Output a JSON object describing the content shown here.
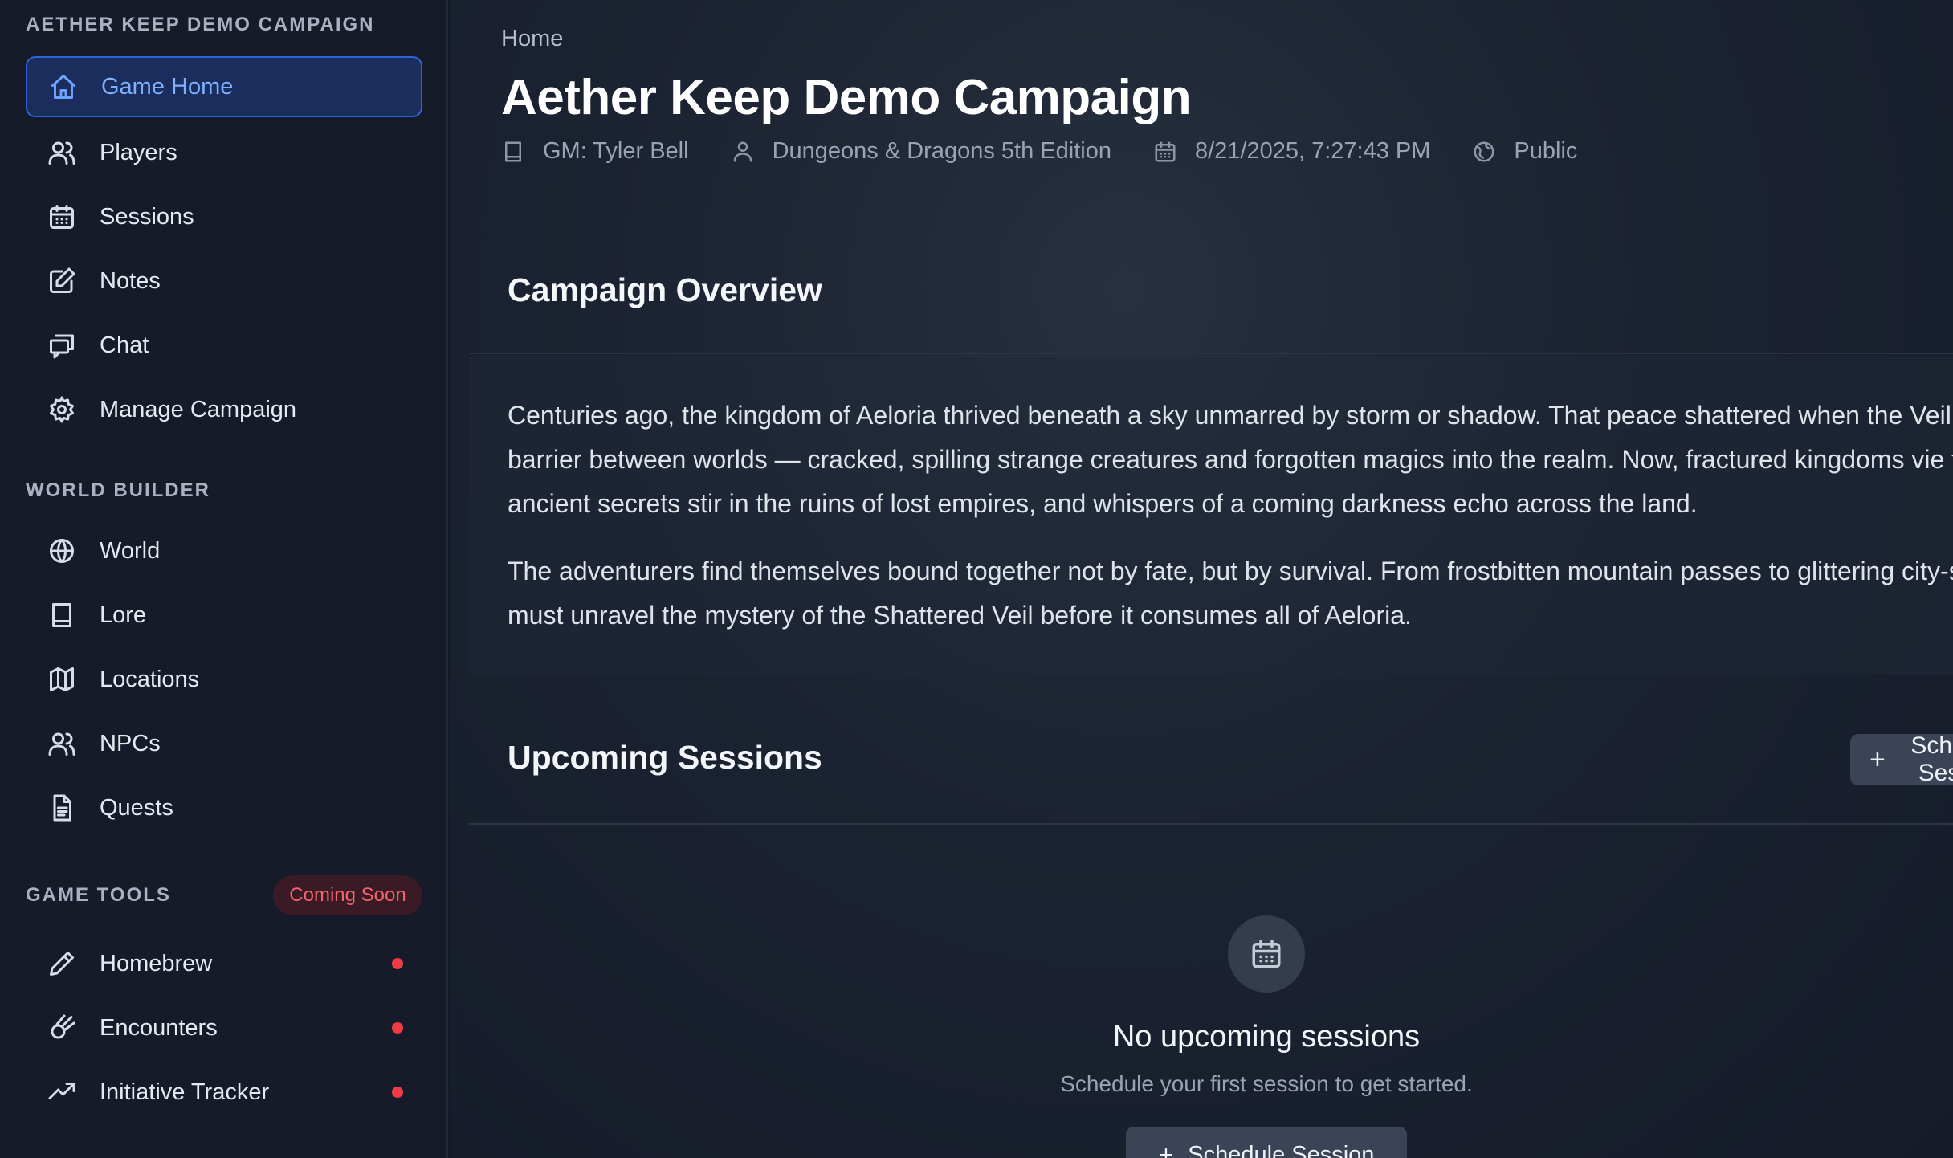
{
  "sidebar": {
    "campaign_heading": "AETHER KEEP DEMO CAMPAIGN",
    "main_items": [
      {
        "label": "Game Home",
        "icon": "home-icon",
        "active": true
      },
      {
        "label": "Players",
        "icon": "users-icon"
      },
      {
        "label": "Sessions",
        "icon": "calendar-icon"
      },
      {
        "label": "Notes",
        "icon": "edit-icon"
      },
      {
        "label": "Chat",
        "icon": "chat-icon"
      },
      {
        "label": "Manage Campaign",
        "icon": "gear-icon"
      }
    ],
    "world_builder_heading": "WORLD BUILDER",
    "world_items": [
      {
        "label": "World",
        "icon": "globe-icon"
      },
      {
        "label": "Lore",
        "icon": "book-icon"
      },
      {
        "label": "Locations",
        "icon": "map-icon"
      },
      {
        "label": "NPCs",
        "icon": "users-icon"
      },
      {
        "label": "Quests",
        "icon": "document-icon"
      }
    ],
    "game_tools_heading": "GAME TOOLS",
    "coming_soon_badge": "Coming Soon",
    "tool_items": [
      {
        "label": "Homebrew",
        "icon": "pencil-icon"
      },
      {
        "label": "Encounters",
        "icon": "meteor-icon"
      },
      {
        "label": "Initiative Tracker",
        "icon": "trending-up-icon"
      }
    ]
  },
  "main": {
    "breadcrumb": "Home",
    "title": "Aether Keep Demo Campaign",
    "meta": {
      "gm": "GM: Tyler Bell",
      "system": "Dungeons & Dragons 5th Edition",
      "date": "8/21/2025, 7:27:43 PM",
      "visibility": "Public"
    },
    "overview": {
      "title": "Campaign Overview",
      "paragraphs": [
        "Centuries ago, the kingdom of Aeloria thrived beneath a sky unmarred by storm or shadow. That peace shattered when the Veil — a mystical barrier between worlds — cracked, spilling strange creatures and forgotten magics into the realm. Now, fractured kingdoms vie for power, ancient secrets stir in the ruins of lost empires, and whispers of a coming darkness echo across the land.",
        "The adventurers find themselves bound together not by fate, but by survival. From frostbitten mountain passes to glittering city-states, they must unravel the mystery of the Shattered Veil before it consumes all of Aeloria."
      ]
    },
    "upcoming": {
      "title": "Upcoming Sessions",
      "schedule_button": "Schedule Session",
      "empty_title": "No upcoming sessions",
      "empty_subtitle": "Schedule your first session to get started.",
      "empty_button": "Schedule Session"
    }
  },
  "colors": {
    "accent": "#2f62d9",
    "active_bg": "#1a2d5c",
    "badge_red": "#ef3b45",
    "background": "#141a28"
  }
}
